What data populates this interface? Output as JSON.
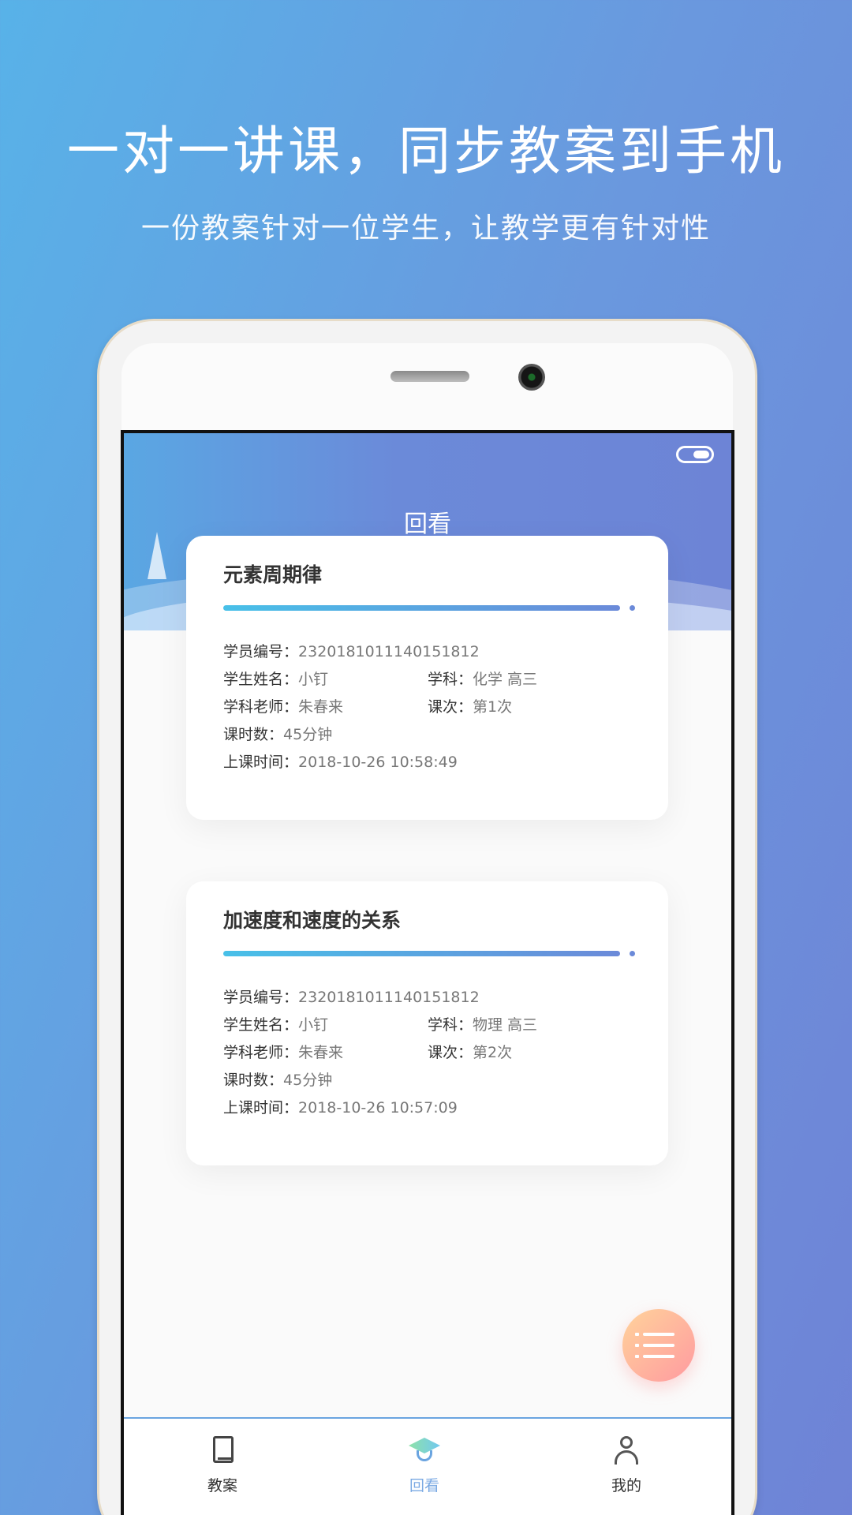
{
  "promo": {
    "headline": "一对一讲课，同步教案到手机",
    "subline": "一份教案针对一位学生，让教学更有针对性"
  },
  "screen": {
    "title": "回看",
    "cards": [
      {
        "title": "元素周期律",
        "student_id_label": "学员编号：",
        "student_id": "2320181011140151812",
        "student_name_label": "学生姓名：",
        "student_name": "小钉",
        "subject_label": "学科：",
        "subject": "化学 高三",
        "teacher_label": "学科老师：",
        "teacher": "朱春来",
        "lesson_no_label": "课次：",
        "lesson_no": "第1次",
        "duration_label": "课时数：",
        "duration": "45分钟",
        "time_label": "上课时间：",
        "time": "2018-10-26 10:58:49"
      },
      {
        "title": "加速度和速度的关系",
        "student_id_label": "学员编号：",
        "student_id": "2320181011140151812",
        "student_name_label": "学生姓名：",
        "student_name": "小钉",
        "subject_label": "学科：",
        "subject": "物理 高三",
        "teacher_label": "学科老师：",
        "teacher": "朱春来",
        "lesson_no_label": "课次：",
        "lesson_no": "第2次",
        "duration_label": "课时数：",
        "duration": "45分钟",
        "time_label": "上课时间：",
        "time": "2018-10-26 10:57:09"
      }
    ],
    "fab_icon": "list-icon",
    "tabs": [
      {
        "label": "教案",
        "icon": "book-icon",
        "active": false
      },
      {
        "label": "回看",
        "icon": "graduation-cap-icon",
        "active": true
      },
      {
        "label": "我的",
        "icon": "user-icon",
        "active": false
      }
    ]
  },
  "colors": {
    "background_start": "#58b2e8",
    "background_end": "#6f83d6",
    "active_tab": "#7aa9e3",
    "fab_start": "#ffd39b",
    "fab_end": "#ff9aa0"
  }
}
